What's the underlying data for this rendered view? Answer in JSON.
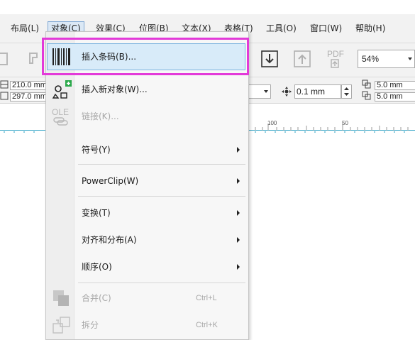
{
  "menubar": {
    "items": [
      {
        "label": "布局(L)"
      },
      {
        "label": "对象(C)"
      },
      {
        "label": "效果(C)"
      },
      {
        "label": "位图(B)"
      },
      {
        "label": "文本(X)"
      },
      {
        "label": "表格(T)"
      },
      {
        "label": "工具(O)"
      },
      {
        "label": "窗口(W)"
      },
      {
        "label": "帮助(H)"
      }
    ]
  },
  "toolbar": {
    "zoom": "54%",
    "pdf_label": "PDF"
  },
  "propbar": {
    "width": "210.0 mm",
    "height": "297.0 mm",
    "nudge": "0.1 mm",
    "dup_x": "5.0 mm",
    "dup_y": "5.0 mm"
  },
  "ruler": {
    "labels": [
      "100",
      "50"
    ]
  },
  "dropdown": {
    "items": [
      {
        "label": "插入条码(B)...",
        "icon": "barcode-icon",
        "enabled": true
      },
      {
        "label": "插入新对象(W)...",
        "icon": "insert-object-icon",
        "enabled": true
      },
      {
        "label": "链接(K)...",
        "icon": "ole-link-icon",
        "enabled": false
      },
      {
        "label": "符号(Y)",
        "submenu": true,
        "enabled": true
      },
      {
        "label": "PowerClip(W)",
        "submenu": true,
        "enabled": true
      },
      {
        "label": "变换(T)",
        "submenu": true,
        "enabled": true
      },
      {
        "label": "对齐和分布(A)",
        "submenu": true,
        "enabled": true
      },
      {
        "label": "顺序(O)",
        "submenu": true,
        "enabled": true
      },
      {
        "label": "合并(C)",
        "shortcut": "Ctrl+L",
        "icon": "combine-icon",
        "enabled": false
      },
      {
        "label": "拆分",
        "shortcut": "Ctrl+K",
        "icon": "break-apart-icon",
        "enabled": false
      }
    ]
  },
  "colors": {
    "highlight_border": "#e33ad9",
    "selected_item_bg": "#d8ebf9",
    "ruler_line": "#35a6c7"
  }
}
